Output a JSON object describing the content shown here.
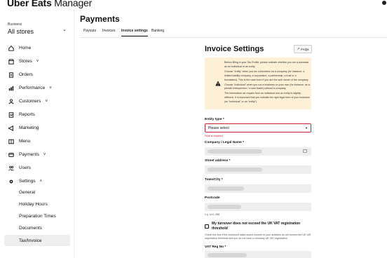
{
  "app": {
    "brand_bold": "Uber Eats",
    "brand_rest": " Manager"
  },
  "sidebar": {
    "store_caption": "Business",
    "store_value": "All stores",
    "items": [
      {
        "label": "Home",
        "icon": "home-icon"
      },
      {
        "label": "Stores",
        "icon": "store-icon",
        "has_chevron": true
      },
      {
        "label": "Orders",
        "icon": "orders-icon"
      },
      {
        "label": "Performance",
        "icon": "chart-icon",
        "has_chevron": true
      },
      {
        "label": "Customers",
        "icon": "customers-icon",
        "has_chevron": true
      },
      {
        "label": "Reports",
        "icon": "reports-icon"
      },
      {
        "label": "Marketing",
        "icon": "megaphone-icon"
      },
      {
        "label": "Menu",
        "icon": "menu-book-icon"
      },
      {
        "label": "Payments",
        "icon": "payments-icon",
        "has_chevron": true
      },
      {
        "label": "Users",
        "icon": "users-icon"
      },
      {
        "label": "Settings",
        "icon": "gear-icon",
        "expanded": true
      }
    ],
    "settings_sub": [
      "General",
      "Holiday Hours",
      "Preparation Times",
      "Documents",
      "Tax/Invoice"
    ],
    "active_sub": "Tax/Invoice"
  },
  "main": {
    "title": "Payments",
    "tabs": [
      "Payouts",
      "Invoices",
      "Invoice settings",
      "Banking"
    ],
    "active_tab": "Invoice settings"
  },
  "form": {
    "title": "Invoice Settings",
    "faq_label": "FAQs",
    "notice": [
      "Before filling in your Tax Profile, please indicate whether you run a business as an individual or an entity.",
      "Choose \"entity\" when you run a business via a company (for instance, a limited liability company, a corporation, a partnership, a trust or a foundation). This is the case even if you are the sole owner of the company.",
      "Choose \"individual\" when you run a business on your own (for instance, as a private entrepreneur / a sole trader) without a company.",
      "The information we require from an individual and an entity is slightly different. It is important that you indicate the right legal form of your business (as \"individual\" or an \"entity\")."
    ],
    "entity_type_label": "Entity type *",
    "entity_type_value": "Please select",
    "entity_type_error": "Field is required",
    "company_label": "Company / Legal Name *",
    "street_label": "Street address *",
    "town_label": "Town/City *",
    "postcode_label": "Postcode",
    "postcode_hint": "e.g. AA1 2BB",
    "vat_checkbox_label": "My turnover does not exceed the UK VAT registration threshold",
    "vat_checkbox_help": "Check this box if the combined sales and/or income of your activities do not exceed the UK VAT registration threshold and you do not have a voluntary UK VAT registration.",
    "vat_reg_label": "VAT Reg No *"
  },
  "colors": {
    "notice_bg": "#fdf0d6",
    "error": "#cc2233",
    "active_bg": "#eeeeee"
  }
}
